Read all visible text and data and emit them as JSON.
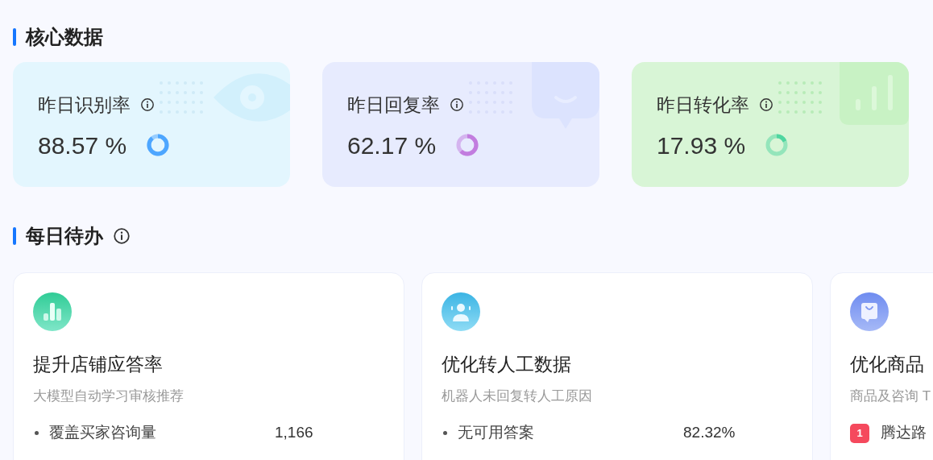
{
  "core_section": {
    "title": "核心数据"
  },
  "stats": [
    {
      "kind": "eye",
      "label": "昨日识别率",
      "value": "88.57 %",
      "level": 0.8857
    },
    {
      "kind": "chat",
      "label": "昨日回复率",
      "value": "62.17 %",
      "level": 0.6217
    },
    {
      "kind": "bars",
      "label": "昨日转化率",
      "value": "17.93 %",
      "level": 0.1793
    }
  ],
  "todo_section": {
    "title": "每日待办"
  },
  "todos": [
    {
      "kind": "chart",
      "title": "提升店铺应答率",
      "subtitle": "大模型自动学习审核推荐",
      "rows": [
        {
          "kind": "bullet",
          "label": "覆盖买家咨询量",
          "value": "1,166"
        }
      ]
    },
    {
      "kind": "agent",
      "title": "优化转人工数据",
      "subtitle": "机器人未回复转人工原因",
      "rows": [
        {
          "kind": "bullet",
          "label": "无可用答案",
          "value": "82.32%"
        }
      ]
    },
    {
      "kind": "bag",
      "title": "优化商品",
      "subtitle": "商品及咨询 T",
      "rows": [
        {
          "kind": "rank",
          "rank": "1",
          "label": "腾达路"
        }
      ]
    }
  ]
}
